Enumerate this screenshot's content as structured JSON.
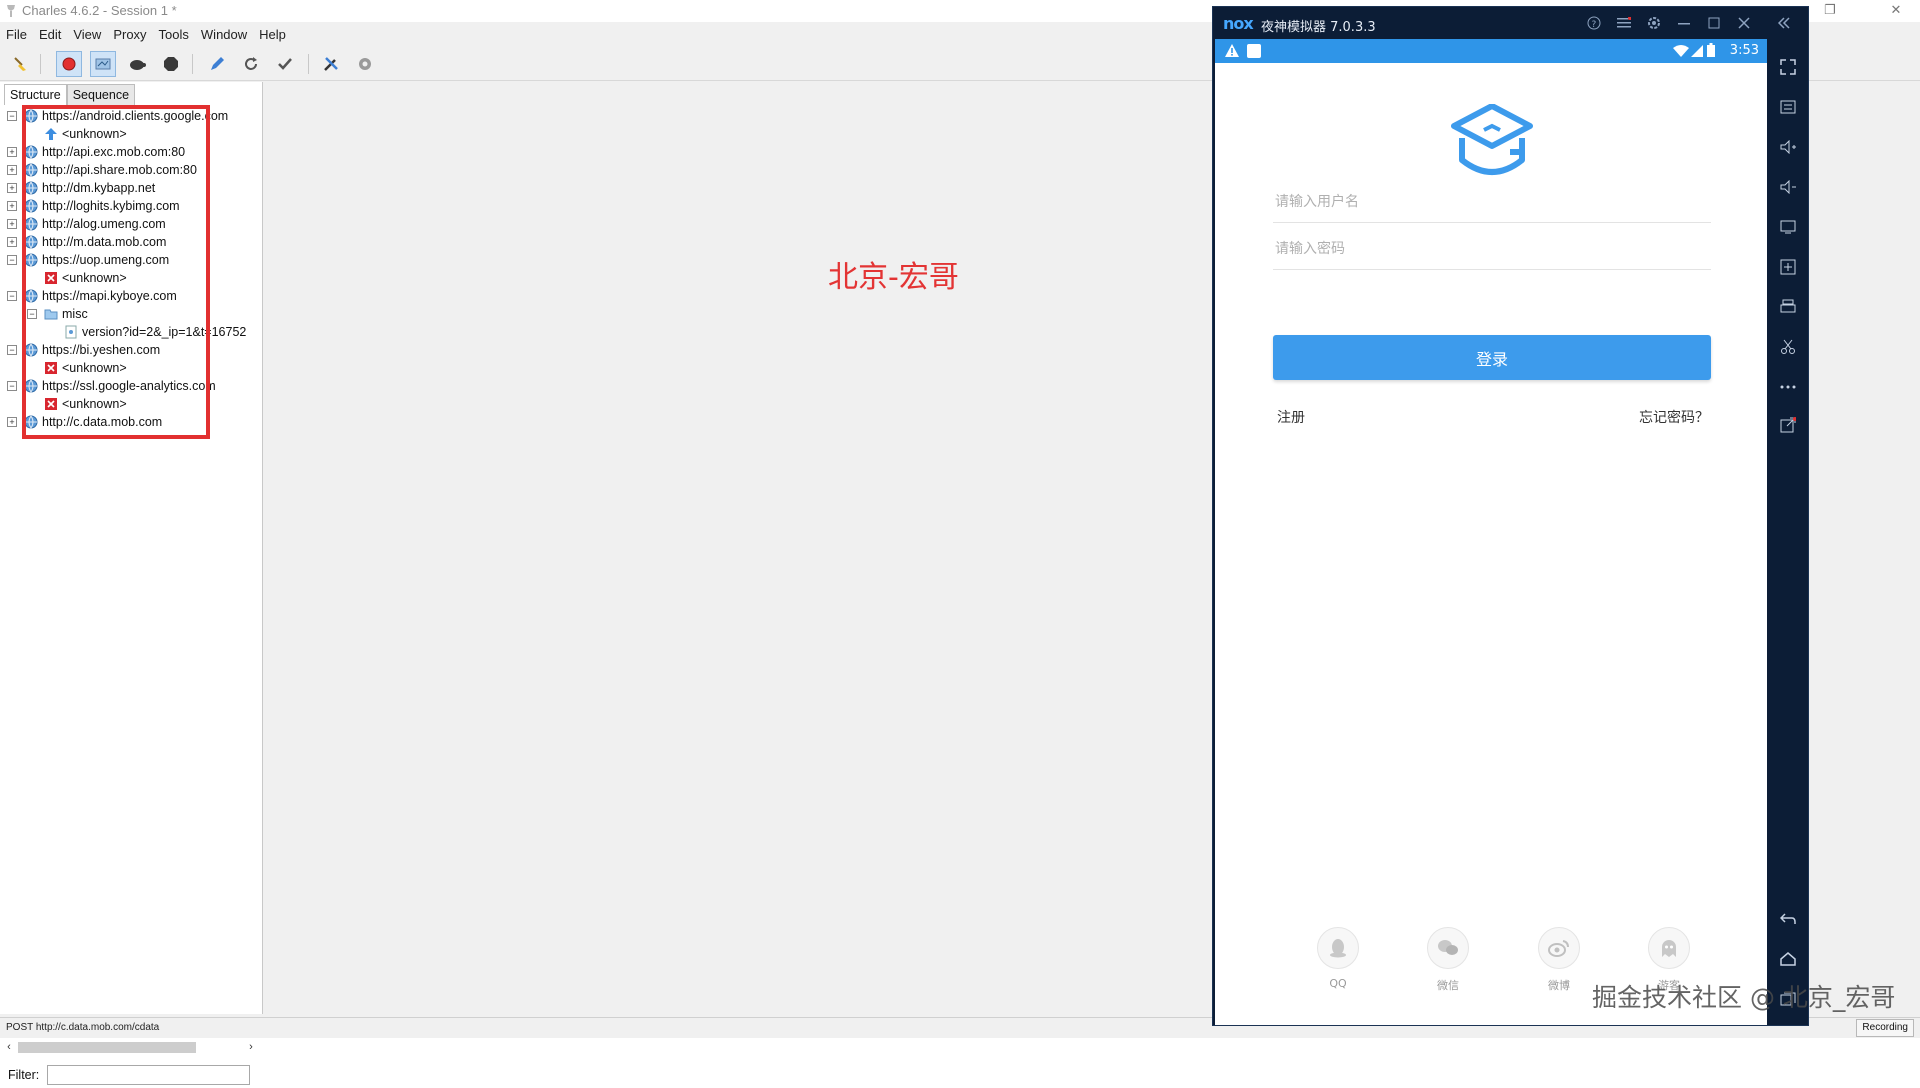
{
  "window": {
    "title": "Charles 4.6.2 - Session 1 *"
  },
  "menu": [
    "File",
    "Edit",
    "View",
    "Proxy",
    "Tools",
    "Window",
    "Help"
  ],
  "toolbar": {
    "icons": [
      "broom-icon",
      "record-icon",
      "throttle-icon",
      "turtle-icon",
      "stop-icon",
      "pen-icon",
      "refresh-icon",
      "check-icon",
      "tools-icon",
      "settings-icon"
    ]
  },
  "tabs": [
    "Structure",
    "Sequence"
  ],
  "tree": [
    {
      "text": "https://android.clients.google.com",
      "level": 0,
      "expanded": true,
      "icon": "globe-icon"
    },
    {
      "text": "<unknown>",
      "level": 1,
      "icon": "upload-arrow-icon"
    },
    {
      "text": "http://api.exc.mob.com:80",
      "level": 0,
      "expanded": false,
      "icon": "globe-icon"
    },
    {
      "text": "http://api.share.mob.com:80",
      "level": 0,
      "expanded": false,
      "icon": "globe-icon"
    },
    {
      "text": "http://dm.kybapp.net",
      "level": 0,
      "expanded": false,
      "icon": "globe-icon"
    },
    {
      "text": "http://loghits.kybimg.com",
      "level": 0,
      "expanded": false,
      "icon": "globe-icon"
    },
    {
      "text": "http://alog.umeng.com",
      "level": 0,
      "expanded": false,
      "icon": "globe-icon"
    },
    {
      "text": "http://m.data.mob.com",
      "level": 0,
      "expanded": false,
      "icon": "globe-icon"
    },
    {
      "text": "https://uop.umeng.com",
      "level": 0,
      "expanded": true,
      "icon": "globe-icon"
    },
    {
      "text": "<unknown>",
      "level": 1,
      "icon": "error-x-icon"
    },
    {
      "text": "https://mapi.kyboye.com",
      "level": 0,
      "expanded": true,
      "icon": "globe-icon"
    },
    {
      "text": "misc",
      "level": 1,
      "expanded": true,
      "icon": "folder-icon"
    },
    {
      "text": "version?id=2&_ip=1&t=16752",
      "level": 2,
      "icon": "file-icon"
    },
    {
      "text": "https://bi.yeshen.com",
      "level": 0,
      "expanded": true,
      "icon": "globe-icon"
    },
    {
      "text": "<unknown>",
      "level": 1,
      "icon": "error-x-icon"
    },
    {
      "text": "https://ssl.google-analytics.com",
      "level": 0,
      "expanded": true,
      "icon": "globe-icon"
    },
    {
      "text": "<unknown>",
      "level": 1,
      "icon": "error-x-icon"
    },
    {
      "text": "http://c.data.mob.com",
      "level": 0,
      "expanded": false,
      "icon": "globe-icon"
    }
  ],
  "filter": {
    "label": "Filter:",
    "value": ""
  },
  "status": {
    "message": "POST http://c.data.mob.com/cdata",
    "recording": "Recording"
  },
  "overlay_text": "北京-宏哥",
  "nox": {
    "logo": "nox",
    "title": "夜神模拟器 7.0.3.3",
    "status_time": "3:53",
    "colors": {
      "frame": "#0c1d36",
      "statusbar": "#2f95e8",
      "accent": "#3d9bec",
      "logo": "#46a8ff"
    }
  },
  "app": {
    "username_placeholder": "请输入用户名",
    "password_placeholder": "请输入密码",
    "login_label": "登录",
    "register_label": "注册",
    "forgot_label": "忘记密码？",
    "social": [
      {
        "label": "QQ",
        "icon": "qq-penguin-icon"
      },
      {
        "label": "微信",
        "icon": "wechat-icon"
      },
      {
        "label": "微博",
        "icon": "weibo-icon"
      },
      {
        "label": "游客",
        "icon": "ghost-icon"
      }
    ]
  },
  "watermark": "掘金技术社区 @ 北京_宏哥"
}
